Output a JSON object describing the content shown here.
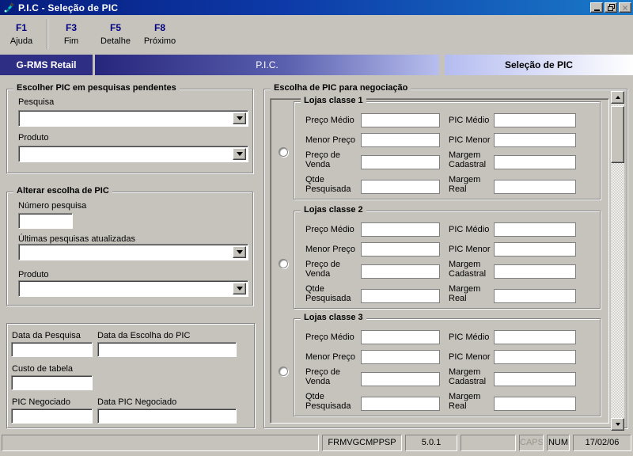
{
  "window": {
    "title": "P.I.C - Seleção de PIC"
  },
  "toolbar": {
    "buttons": [
      {
        "key": "F1",
        "label": "Ajuda"
      },
      {
        "key": "F3",
        "label": "Fim"
      },
      {
        "key": "F5",
        "label": "Detalhe"
      },
      {
        "key": "F8",
        "label": "Próximo"
      }
    ]
  },
  "header": {
    "brand": "G-RMS Retail",
    "module": "P.I.C.",
    "screen": "Seleção de PIC"
  },
  "left_panel": {
    "pending_group": {
      "title": "Escolher PIC em pesquisas pendentes",
      "fields": {
        "pesquisa": "Pesquisa",
        "produto": "Produto"
      }
    },
    "change_group": {
      "title": "Alterar escolha de PIC",
      "fields": {
        "numero": "Número pesquisa",
        "ultimas": "Últimas pesquisas atualizadas",
        "produto": "Produto"
      }
    },
    "dates_group": {
      "fields": {
        "data_pesquisa": "Data da Pesquisa",
        "data_escolha": "Data da Escolha do PIC",
        "custo_tabela": "Custo de tabela",
        "pic_negociado": "PIC Negociado",
        "data_pic_negociado": "Data PIC Negociado"
      }
    }
  },
  "right_panel": {
    "title": "Escolha de PIC para negociação",
    "store_classes": [
      {
        "title": "Lojas classe 1"
      },
      {
        "title": "Lojas classe 2"
      },
      {
        "title": "Lojas classe 3"
      }
    ],
    "field_labels": {
      "preco_medio": "Preço Médio",
      "pic_medio": "PIC Médio",
      "menor_preco": "Menor Preço",
      "pic_menor": "PIC Menor",
      "preco_venda": "Preço de Venda",
      "margem_cadastral": "Margem Cadastral",
      "qtde_pesquisada": "Qtde Pesquisada",
      "margem_real": "Margem Real"
    }
  },
  "statusbar": {
    "form_id": "FRMVGCMPPSP",
    "version": "5.0.1",
    "caps": "CAPS",
    "num": "NUM",
    "date": "17/02/06"
  },
  "colors": {
    "titlebar_start": "#071d7e",
    "titlebar_end": "#1a7ac8",
    "brand_bg": "#2e2e85",
    "header_gradient_dark": "#26267c",
    "header_gradient_light": "#b8bfee",
    "fkey_text": "#000080",
    "window_face": "#c6c3bd",
    "disabled_text": "#9a968e"
  }
}
